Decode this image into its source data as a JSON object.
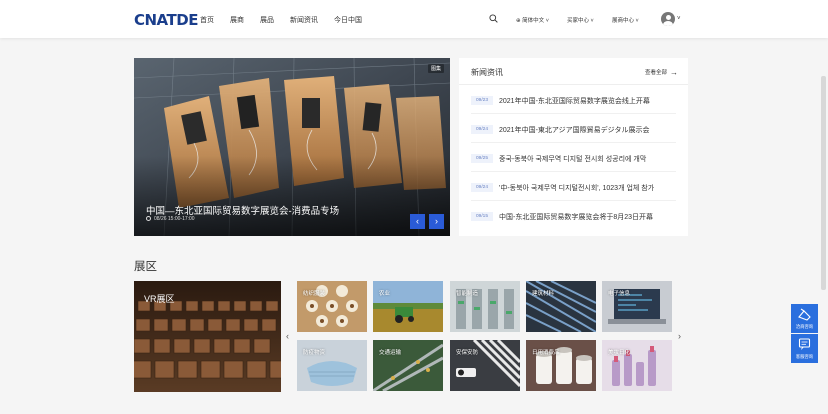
{
  "header": {
    "logo": "CNATDE",
    "nav": [
      "首页",
      "展商",
      "展品",
      "新闻资讯",
      "今日中国"
    ],
    "language": "简体中文",
    "buyer_center": "买家中心",
    "exhibitor_center": "展商中心"
  },
  "banner": {
    "tag": "图集",
    "title": "中国—东北亚国际贸易数字展览会-消费品专场",
    "date": "08/26 15:00-17:00"
  },
  "news": {
    "title": "新闻资讯",
    "view_all": "查看全部",
    "items": [
      {
        "date": "09/23",
        "text": "2021年中国-东北亚国际贸易数字展览会线上开幕"
      },
      {
        "date": "09/24",
        "text": "2021年中国-東北アジア国際貿易デジタル展示会"
      },
      {
        "date": "09/25",
        "text": "중국-동북아 국제무역 디지털 전시회 성공리에 개막"
      },
      {
        "date": "09/24",
        "text": "'中-동북아 국제무역 디지털전시회', 1023개 업체 참가"
      },
      {
        "date": "09/15",
        "text": "中国-东北亚国际贸易数字展览会将于8月23日开幕"
      }
    ]
  },
  "exhibition": {
    "title": "展区",
    "vr_label": "VR展区",
    "cards": [
      {
        "label": "纺织服装"
      },
      {
        "label": "农业"
      },
      {
        "label": "智能制造"
      },
      {
        "label": "建筑材料"
      },
      {
        "label": "电子信息"
      },
      {
        "label": "防疫物资"
      },
      {
        "label": "交通运输"
      },
      {
        "label": "安保安防"
      },
      {
        "label": "日用消费品"
      },
      {
        "label": "美妆日化"
      }
    ]
  },
  "float": {
    "consult": "洽商咨询",
    "service": "客服咨询"
  }
}
